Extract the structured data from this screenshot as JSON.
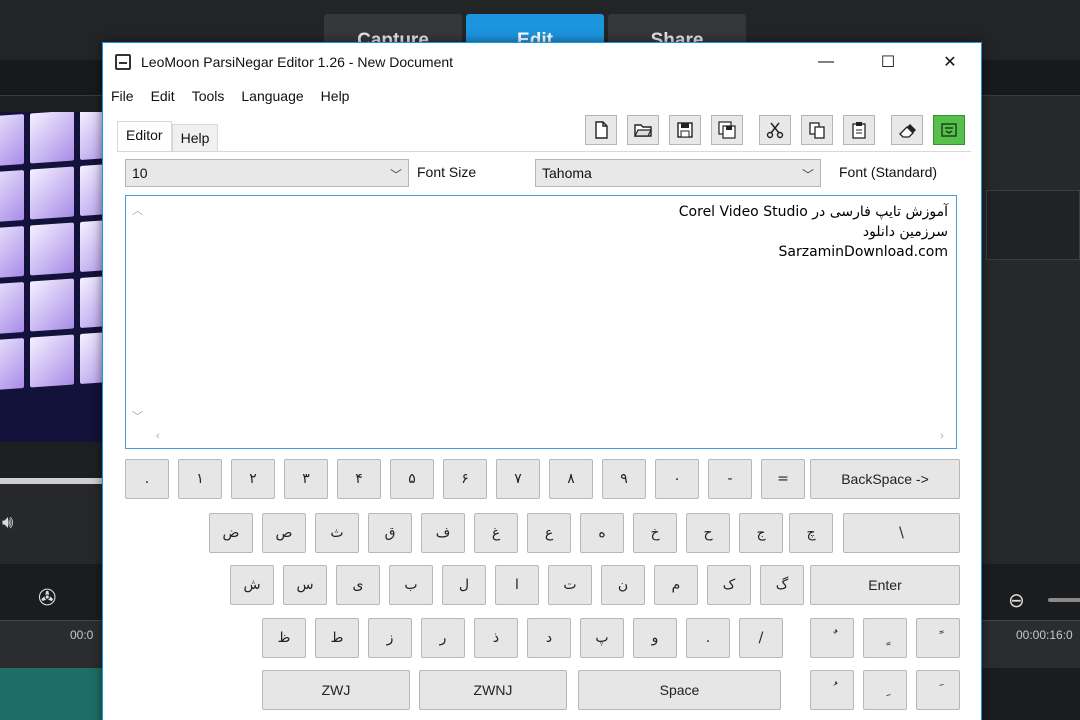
{
  "background": {
    "tabs": [
      "Capture",
      "Edit",
      "Share"
    ],
    "active_tab": 1,
    "timecode_left": "00:0",
    "timecode_right": "00:00:16:0"
  },
  "window": {
    "title": "LeoMoon ParsiNegar Editor 1.26 - New Document",
    "accent": "#1c94de",
    "controls": {
      "minimize": "—",
      "maximize": "☐",
      "close": "✕"
    },
    "menu": [
      "File",
      "Edit",
      "Tools",
      "Language",
      "Help"
    ]
  },
  "tabs": [
    "Editor",
    "Help"
  ],
  "toolbar": [
    {
      "name": "new-icon"
    },
    {
      "name": "open-icon"
    },
    {
      "name": "save-icon"
    },
    {
      "name": "save-as-icon"
    },
    {
      "name": "cut-icon"
    },
    {
      "name": "copy-icon"
    },
    {
      "name": "paste-icon"
    },
    {
      "name": "eraser-icon"
    },
    {
      "name": "keyboard-icon"
    }
  ],
  "font_size": {
    "value": "10",
    "label": "Font Size"
  },
  "font": {
    "value": "Tahoma",
    "label": "Font (Standard)"
  },
  "editor_lines": [
    "آموزش تایپ فارسی در Corel Video Studio",
    "سرزمین دانلود",
    "SarzaminDownload.com"
  ],
  "keyboard": {
    "row1": [
      ".",
      "١",
      "٢",
      "٣",
      "۴",
      "۵",
      "۶",
      "٧",
      "٨",
      "٩",
      "٠",
      "-",
      "=",
      "BackSpace ->"
    ],
    "row2": [
      "ض",
      "ص",
      "ث",
      "ق",
      "ف",
      "غ",
      "ع",
      "ه",
      "خ",
      "ح",
      "ج",
      "چ",
      "\\"
    ],
    "row3": [
      "ش",
      "س",
      "ی",
      "ب",
      "ل",
      "ا",
      "ت",
      "ن",
      "م",
      "ک",
      "گ",
      "Enter"
    ],
    "row4": [
      "ظ",
      "ط",
      "ز",
      "ر",
      "ذ",
      "د",
      "پ",
      "و",
      ".",
      "/",
      "ٌ",
      "ٍ",
      "ً"
    ],
    "row5": [
      "ZWJ",
      "ZWNJ",
      "Space",
      "ُ",
      "ِ",
      "َ"
    ]
  }
}
